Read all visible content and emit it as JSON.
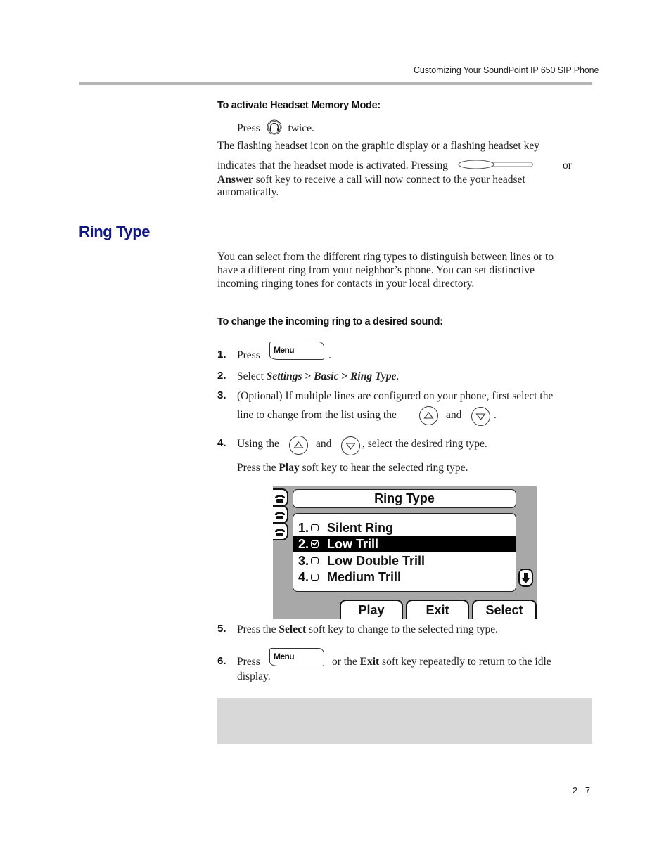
{
  "header": {
    "running_title": "Customizing Your SoundPoint IP 650 SIP Phone"
  },
  "headset_section": {
    "procedure_heading": "To activate Headset Memory Mode:",
    "press_prefix": "Press",
    "press_suffix": "twice.",
    "press_icon": "headset-key-icon",
    "para_line1": "The flashing headset icon on the graphic display or a flashing headset key",
    "para_line2_prefix": "indicates that the headset mode is activated. Pressing",
    "para_line2_icon": "answer-key-icon",
    "para_line2_suffix": "or",
    "para_line3_bold": "Answer",
    "para_line3_rest": " soft key to receive a call will now connect to the your headset",
    "para_line4": "automatically."
  },
  "ring_type_section": {
    "title": "Ring Type",
    "intro_lines": [
      "You can select from the different ring types to distinguish between lines or to",
      "have a different ring from your neighbor’s phone. You can set distinctive",
      "incoming ringing tones for contacts in your local directory."
    ],
    "procedure_heading": "To change the incoming ring to a desired sound:",
    "steps": [
      {
        "num": "1.",
        "prefix": "Press",
        "key_label": "Menu",
        "suffix": "."
      },
      {
        "num": "2.",
        "prefix": "Select ",
        "path": [
          "Settings",
          "Basic",
          "Ring Type"
        ],
        "separator": " > ",
        "suffix": "."
      },
      {
        "num": "3.",
        "line1": "(Optional) If multiple lines are configured on your phone, first select the",
        "line2_prefix": "line to change from the list using the",
        "and": "and",
        "suffix": "."
      },
      {
        "num": "4.",
        "prefix": "Using the",
        "and": "and",
        "suffix": ", select the desired ring type.",
        "sub_prefix": "Press the ",
        "sub_bold": "Play",
        "sub_rest": " soft key to hear the selected ring type."
      },
      {
        "num": "5.",
        "prefix": "Press the ",
        "bold": "Select",
        "rest": " soft key to change to the selected ring type."
      },
      {
        "num": "6.",
        "prefix": "Press",
        "key_label": "Menu",
        "mid": "or the ",
        "bold": "Exit",
        "rest": " soft key repeatedly to return to the idle",
        "line2": "display."
      }
    ]
  },
  "phone_screen": {
    "title": "Ring Type",
    "items": [
      {
        "num": "1.",
        "label": "Silent Ring",
        "checked": false,
        "selected": false
      },
      {
        "num": "2.",
        "label": "Low Trill",
        "checked": true,
        "selected": true
      },
      {
        "num": "3.",
        "label": "Low Double Trill",
        "checked": false,
        "selected": false
      },
      {
        "num": "4.",
        "label": "Medium Trill",
        "checked": false,
        "selected": false
      }
    ],
    "softkeys": [
      "Play",
      "Exit",
      "Select"
    ],
    "line_tab_icons": [
      "phone-line-icon",
      "phone-line-icon",
      "phone-line-icon"
    ],
    "scroll_icon": "scroll-down-arrow-icon"
  },
  "footer": {
    "page_number": "2 - 7"
  },
  "colors": {
    "section_title": "#101a82",
    "header_rule": "#b5b5b5",
    "note_box": "#d8d8d8",
    "screen_bg": "#a8a8a8"
  }
}
